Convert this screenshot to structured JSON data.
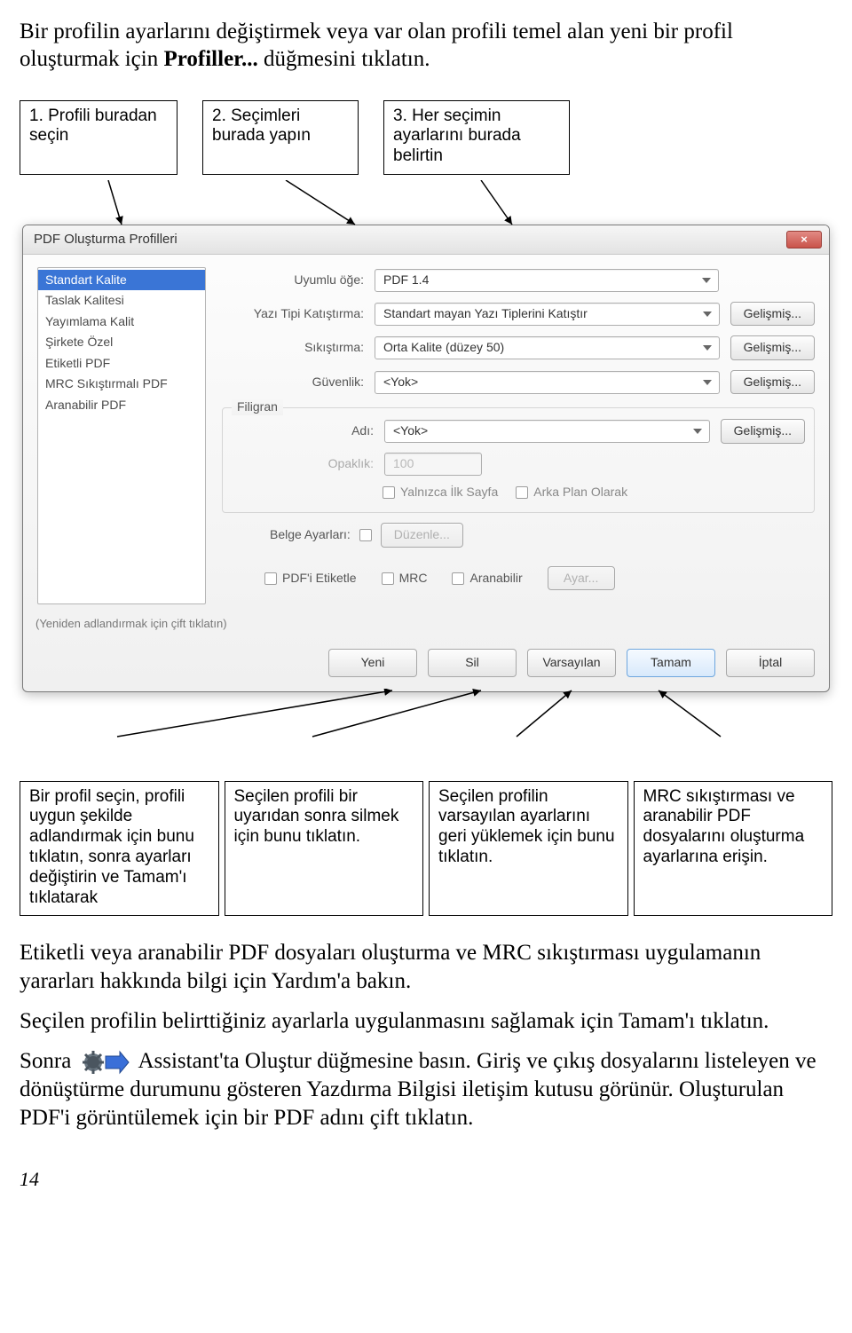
{
  "intro": {
    "line1": "Bir profilin ayarlarını değiştirmek veya var olan profili temel alan yeni bir profil oluşturmak için ",
    "bold": "Profiller...",
    "line1_end": " düğmesini tıklatın."
  },
  "topCallouts": {
    "c1": "1. Profili buradan seçin",
    "c2": "2. Seçimleri burada yapın",
    "c3": "3. Her seçimin ayarlarını burada belirtin"
  },
  "dialog": {
    "title": "PDF Oluşturma Profilleri",
    "close": "×",
    "profiles": [
      "Standart Kalite",
      "Taslak Kalitesi",
      "Yayımlama Kalit",
      "Şirkete Özel",
      "Etiketli PDF",
      "MRC Sıkıştırmalı PDF",
      "Aranabilir PDF"
    ],
    "labels": {
      "uyumlu": "Uyumlu öğe:",
      "yazitipi": "Yazı Tipi Katıştırma:",
      "sikistirma": "Sıkıştırma:",
      "guvenlik": "Güvenlik:",
      "filigran": "Filigran",
      "adi": "Adı:",
      "opaklik": "Opaklık:",
      "yalnizca": "Yalnızca İlk Sayfa",
      "arkaplan": "Arka Plan Olarak",
      "belge": "Belge Ayarları:",
      "duzenle": "Düzenle...",
      "pdfetiket": "PDF'i Etiketle",
      "mrc": "MRC",
      "aranabilir": "Aranabilir",
      "ayar": "Ayar..."
    },
    "values": {
      "uyumlu": "PDF 1.4",
      "yazitipi": "Standart       mayan Yazı Tiplerini Katıştır",
      "sikistirma": "Orta Kalite (düzey 50)",
      "guvenlik": "<Yok>",
      "adi": "<Yok>",
      "opaklik": "100"
    },
    "btn_advanced": "Gelişmiş...",
    "hint": "(Yeniden adlandırmak için çift tıklatın)",
    "footer": {
      "yeni": "Yeni",
      "sil": "Sil",
      "varsayilan": "Varsayılan",
      "tamam": "Tamam",
      "iptal": "İptal"
    }
  },
  "lowerCallouts": {
    "l1": "Bir profil seçin, profili uygun şekilde adlandırmak için bunu tıklatın, sonra ayarları değiştirin ve Tamam'ı tıklatarak",
    "l2": "Seçilen profili bir uyarıdan sonra silmek için bunu tıklatın.",
    "l3": "Seçilen profilin varsayılan ayarlarını geri yüklemek için bunu tıklatın.",
    "l4": "MRC sıkıştırması ve aranabilir PDF dosyalarını oluşturma ayarlarına erişin."
  },
  "body": {
    "p1": "Etiketli veya aranabilir PDF dosyaları oluşturma ve MRC sıkıştırması uygulamanın yararları hakkında bilgi için Yardım'a bakın.",
    "p2": "Seçilen profilin belirttiğiniz ayarlarla uygulanmasını sağlamak için Tamam'ı tıklatın.",
    "p3a": "Sonra",
    "p3b": "Assistant'ta Oluştur düğmesine basın. Giriş ve çıkış dosyalarını listeleyen ve dönüştürme durumunu gösteren Yazdırma Bilgisi iletişim kutusu görünür. Oluşturulan PDF'i görüntülemek için bir PDF adını çift tıklatın."
  },
  "pagenum": "14"
}
